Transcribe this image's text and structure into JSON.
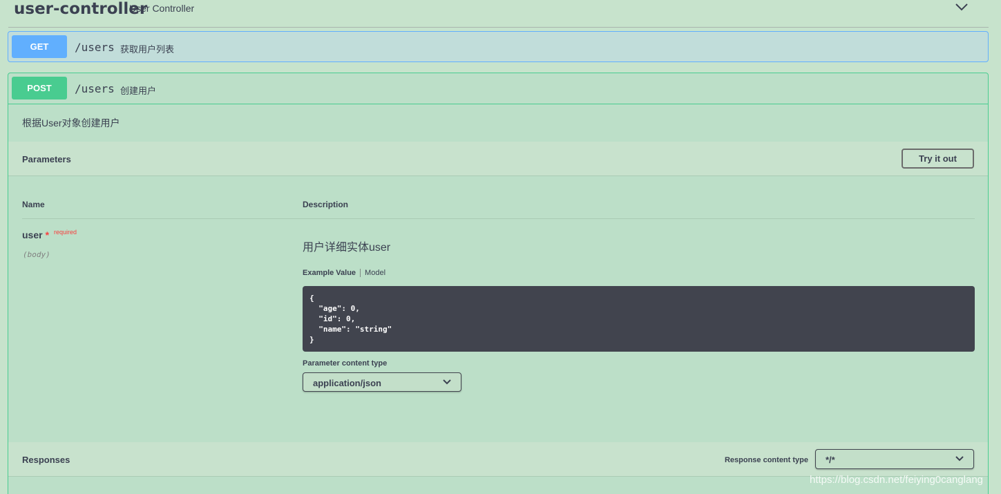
{
  "tag": {
    "name": "user-controller",
    "description": "User Controller"
  },
  "operations": {
    "get": {
      "method": "GET",
      "path": "/users",
      "summary": "获取用户列表"
    },
    "post": {
      "method": "POST",
      "path": "/users",
      "summary": "创建用户",
      "description": "根据User对象创建用户",
      "parameters": {
        "title": "Parameters",
        "try_button": "Try it out",
        "col_name": "Name",
        "col_description": "Description",
        "items": [
          {
            "name": "user",
            "required_star": "*",
            "required_label": "required",
            "in": "(body)",
            "description": "用户详细实体user",
            "tab_example": "Example Value",
            "tab_model": "Model",
            "example": "{\n  \"age\": 0,\n  \"id\": 0,\n  \"name\": \"string\"\n}",
            "content_type_label": "Parameter content type",
            "content_type_value": "application/json"
          }
        ]
      },
      "responses": {
        "title": "Responses",
        "content_type_label": "Response content type",
        "content_type_value": "*/*"
      }
    }
  },
  "watermark": "https://blog.csdn.net/feiying0canglang",
  "colors": {
    "page_bg": "#c7e3cc",
    "get": "#61affe",
    "post": "#49cc90",
    "code_bg": "#41444e",
    "required": "#f93e3e"
  }
}
